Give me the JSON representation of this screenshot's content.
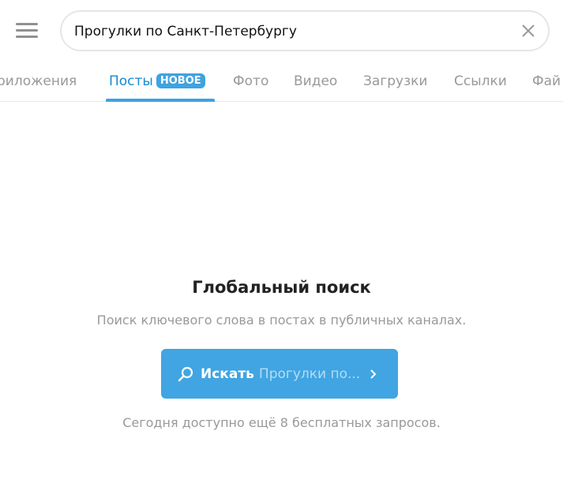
{
  "search": {
    "value": "Прогулки по Санкт-Петербургу"
  },
  "tabs": [
    {
      "label": "риложения"
    },
    {
      "label": "Посты",
      "badge": "НОВОЕ",
      "active": true
    },
    {
      "label": "Фото"
    },
    {
      "label": "Видео"
    },
    {
      "label": "Загрузки"
    },
    {
      "label": "Ссылки"
    },
    {
      "label": "Фай"
    }
  ],
  "empty": {
    "title": "Глобальный поиск",
    "subtitle": "Поиск ключевого слова в постах в публичных каналах.",
    "button_label": "Искать",
    "button_query": "Прогулки по...",
    "note": "Сегодня доступно ещё 8 бесплатных запросов."
  },
  "colors": {
    "accent": "#40a5e2",
    "active_tab": "#168acd"
  }
}
